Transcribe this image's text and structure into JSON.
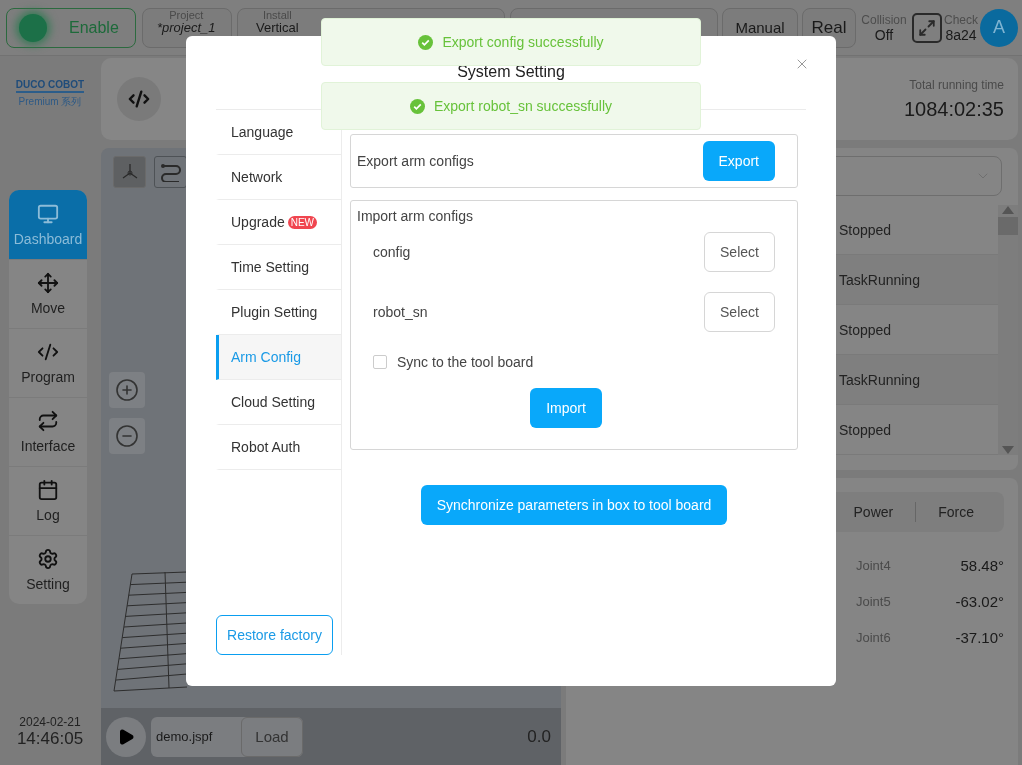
{
  "top_bar": {
    "enable": {
      "label": "Enable",
      "on": true
    },
    "pills": [
      {
        "label": "Project",
        "value": "*project_1"
      },
      {
        "label": "Install",
        "value": "Vertical"
      }
    ],
    "mode_buttons": [
      "Manual",
      "Real"
    ],
    "collision": {
      "label": "Collision",
      "value": "Off"
    },
    "check": {
      "label": "Check",
      "value": "8a24"
    },
    "avatar": "A"
  },
  "logo": {
    "name": "DUCO COBOT",
    "subtitle": "Premium 系列"
  },
  "nav": [
    {
      "label": "Dashboard",
      "selected": true
    },
    {
      "label": "Move",
      "selected": false
    },
    {
      "label": "Program",
      "selected": false
    },
    {
      "label": "Interface",
      "selected": false
    },
    {
      "label": "Log",
      "selected": false
    },
    {
      "label": "Setting",
      "selected": false
    }
  ],
  "clock": {
    "date": "2024-02-21",
    "time": "14:46:05"
  },
  "program_bar": {
    "file": "demo.jspf",
    "load": "Load",
    "speed": "0.0"
  },
  "running_time": {
    "label": "Total running time",
    "value": "1084:02:35"
  },
  "task_list": [
    {
      "status": "Stopped"
    },
    {
      "status": "TaskRunning"
    },
    {
      "status": "Stopped"
    },
    {
      "status": "TaskRunning"
    },
    {
      "status": "Stopped"
    }
  ],
  "joint_tabs": [
    "Power",
    "Force"
  ],
  "joints": [
    {
      "name": "Joint4",
      "value": "58.48°"
    },
    {
      "name": "Joint5",
      "value": "-63.02°"
    },
    {
      "name": "Joint6",
      "value": "-37.10°"
    }
  ],
  "dialog": {
    "title": "System Setting",
    "menu": [
      {
        "label": "Language",
        "selected": false
      },
      {
        "label": "Network",
        "selected": false
      },
      {
        "label": "Upgrade",
        "badge": "NEW",
        "selected": false
      },
      {
        "label": "Time Setting",
        "selected": false
      },
      {
        "label": "Plugin Setting",
        "selected": false
      },
      {
        "label": "Arm Config",
        "selected": true
      },
      {
        "label": "Cloud Setting",
        "selected": false
      },
      {
        "label": "Robot Auth",
        "selected": false
      }
    ],
    "restore_button": "Restore factory",
    "export": {
      "label": "Export arm configs",
      "button": "Export"
    },
    "import": {
      "title": "Import arm configs",
      "files": [
        {
          "name": "config",
          "button": "Select"
        },
        {
          "name": "robot_sn",
          "button": "Select"
        }
      ],
      "sync_option": {
        "label": "Sync to the tool board",
        "checked": false
      },
      "button": "Import"
    },
    "sync_button": "Synchronize parameters in box to tool board"
  },
  "toasts": [
    {
      "message": "Export config successfully"
    },
    {
      "message": "Export robot_sn successfully"
    }
  ]
}
